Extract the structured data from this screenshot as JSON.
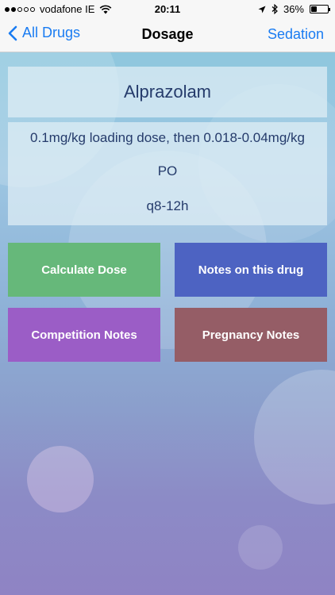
{
  "status_bar": {
    "carrier": "vodafone IE",
    "time": "20:11",
    "battery": "36%",
    "battery_level": 0.36,
    "signal_bars_filled": 2,
    "signal_bars_total": 5
  },
  "nav": {
    "back_label": "All Drugs",
    "title": "Dosage",
    "right_label": "Sedation"
  },
  "drug": {
    "name": "Alprazolam",
    "dose": "0.1mg/kg loading dose, then 0.018-0.04mg/kg",
    "route": "PO",
    "frequency": "q8-12h"
  },
  "buttons": {
    "calculate": "Calculate Dose",
    "notes": "Notes on this drug",
    "competition": "Competition Notes",
    "pregnancy": "Pregnancy Notes"
  },
  "colors": {
    "accent": "#1a7cf2",
    "calculate": "#66b87a",
    "notes": "#4d63c2",
    "competition": "#9b5dc6",
    "pregnancy": "#955d66"
  }
}
